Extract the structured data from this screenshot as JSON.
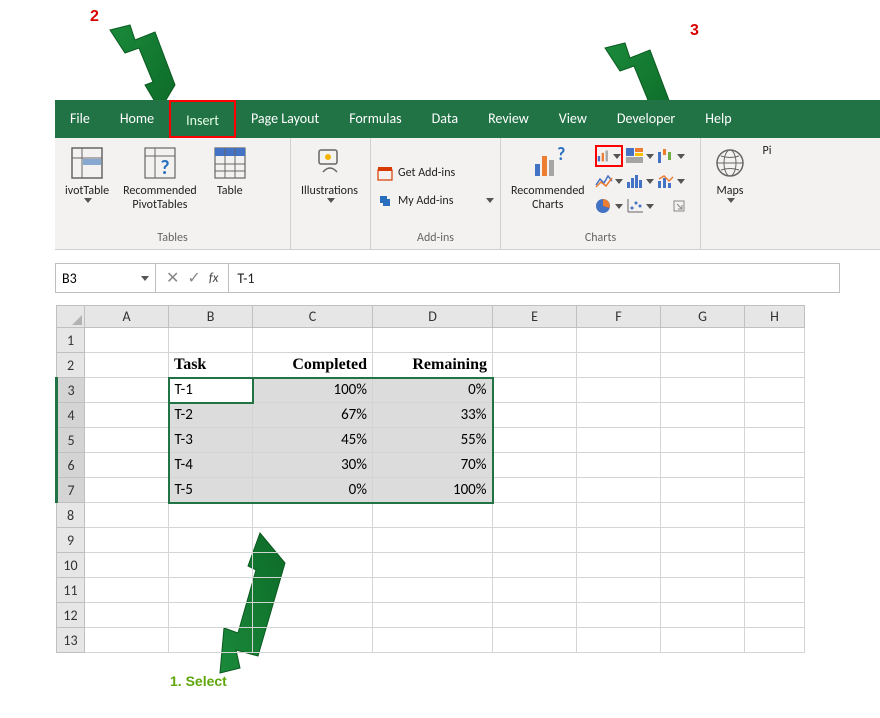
{
  "annotations": {
    "label1": "1. Select",
    "label2": "2",
    "label3": "3"
  },
  "tabs": [
    "File",
    "Home",
    "Insert",
    "Page Layout",
    "Formulas",
    "Data",
    "Review",
    "View",
    "Developer",
    "Help"
  ],
  "active_tab_index": 2,
  "ribbon": {
    "tables": {
      "label": "Tables",
      "pivottable": "ivotTable",
      "recommended_pivot": "Recommended\nPivotTables",
      "table": "Table"
    },
    "illustrations": {
      "label": "Illustrations"
    },
    "addins": {
      "label": "Add-ins",
      "get": "Get Add-ins",
      "my": "My Add-ins"
    },
    "charts": {
      "label": "Charts",
      "recommended": "Recommended\nCharts"
    },
    "maps": {
      "label": "Maps",
      "pi": "Pi"
    }
  },
  "formula": {
    "namebox": "B3",
    "fx_label": "fx",
    "value": "T-1"
  },
  "columns": [
    "A",
    "B",
    "C",
    "D",
    "E",
    "F",
    "G",
    "H"
  ],
  "col_widths": {
    "A": 84,
    "B": 84,
    "C": 120,
    "D": 120,
    "E": 84,
    "F": 84,
    "G": 84,
    "H": 60
  },
  "rows": [
    "1",
    "2",
    "3",
    "4",
    "5",
    "6",
    "7",
    "8",
    "9",
    "10",
    "11",
    "12",
    "13"
  ],
  "table": {
    "headers": {
      "task": "Task",
      "completed": "Completed",
      "remaining": "Remaining"
    },
    "data": [
      {
        "task": "T-1",
        "completed": "100%",
        "remaining": "0%"
      },
      {
        "task": "T-2",
        "completed": "67%",
        "remaining": "33%"
      },
      {
        "task": "T-3",
        "completed": "45%",
        "remaining": "55%"
      },
      {
        "task": "T-4",
        "completed": "30%",
        "remaining": "70%"
      },
      {
        "task": "T-5",
        "completed": "0%",
        "remaining": "100%"
      }
    ]
  },
  "chart_data": {
    "type": "table",
    "title": "",
    "categories": [
      "T-1",
      "T-2",
      "T-3",
      "T-4",
      "T-5"
    ],
    "series": [
      {
        "name": "Completed",
        "values": [
          100,
          67,
          45,
          30,
          0
        ],
        "unit": "%"
      },
      {
        "name": "Remaining",
        "values": [
          0,
          33,
          55,
          70,
          100
        ],
        "unit": "%"
      }
    ]
  }
}
